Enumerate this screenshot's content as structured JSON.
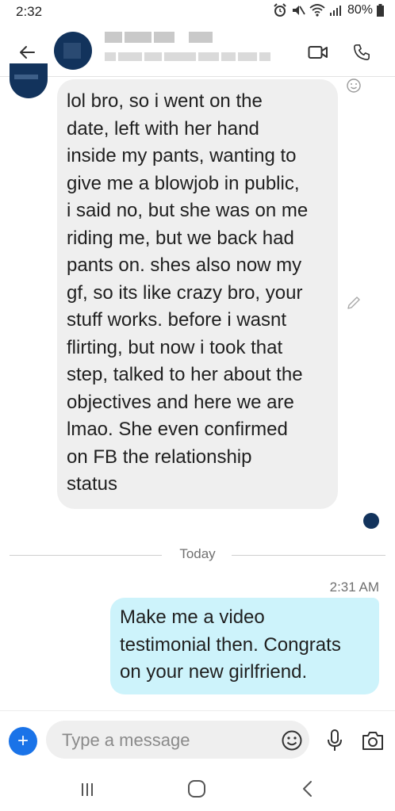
{
  "status_bar": {
    "time": "2:32",
    "battery": "80%",
    "icons": [
      "alarm-icon",
      "mute-icon",
      "wifi-icon",
      "signal-icon",
      "battery-icon"
    ]
  },
  "header": {
    "contact_name": "",
    "contact_status": "",
    "back_icon": "arrow-left-icon",
    "video_icon": "video-call-icon",
    "phone_icon": "phone-call-icon"
  },
  "conversation": {
    "incoming_message": {
      "text": "lol bro, so i went on the\ndate, left with her hand\ninside my pants, wanting to\ngive me a blowjob in public,\ni said no, but she was on me\nriding me, but we back had\npants on. shes also now my\ngf, so its like crazy bro, your\nstuff works. before i wasnt\nflirting, but now i took that\nstep, talked to her about the\nobjectives and here we are\nlmao. She even confirmed\non FB the relationship\nstatus"
    },
    "divider_label": "Today",
    "outgoing_message": {
      "time": "2:31 AM",
      "text": "Make me a video\ntestimonial then. Congrats\non your new girlfriend."
    }
  },
  "compose": {
    "placeholder": "Type a message",
    "add_label": "+"
  },
  "colors": {
    "accent": "#1a73e8",
    "avatar": "#12335c",
    "incoming_bubble": "#efefef",
    "outgoing_bubble": "#cdf3fb"
  }
}
